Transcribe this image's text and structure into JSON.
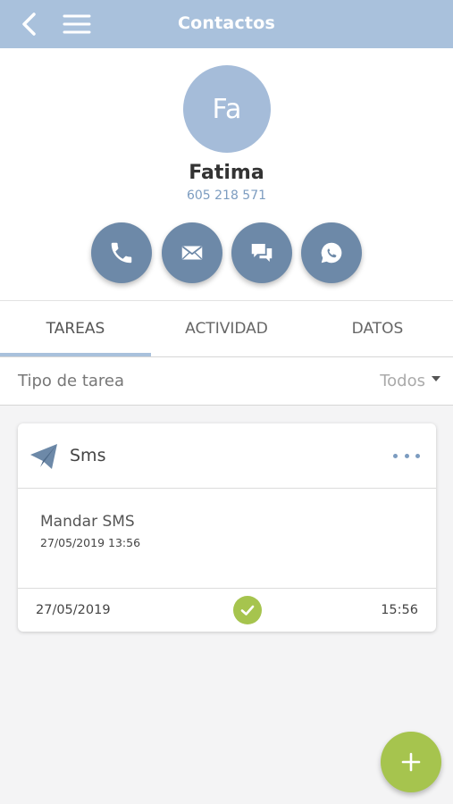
{
  "appbar": {
    "title": "Contactos"
  },
  "contact": {
    "initials": "Fa",
    "name": "Fatima",
    "phone": "605 218 571"
  },
  "actions": [
    "call",
    "email",
    "chat",
    "whatsapp"
  ],
  "tabs": [
    {
      "label": "TAREAS",
      "active": true
    },
    {
      "label": "ACTIVIDAD",
      "active": false
    },
    {
      "label": "DATOS",
      "active": false
    }
  ],
  "filter": {
    "label": "Tipo de tarea",
    "selected": "Todos"
  },
  "task": {
    "type": "Sms",
    "subject": "Mandar SMS",
    "datetime": "27/05/2019 13:56",
    "footer_date": "27/05/2019",
    "footer_time": "15:56",
    "status": "completed"
  },
  "colors": {
    "header": "#a9c1dc",
    "action_buttons": "#6d89a8",
    "accent_green": "#a6c44e",
    "phone_text": "#7c9cc0"
  }
}
